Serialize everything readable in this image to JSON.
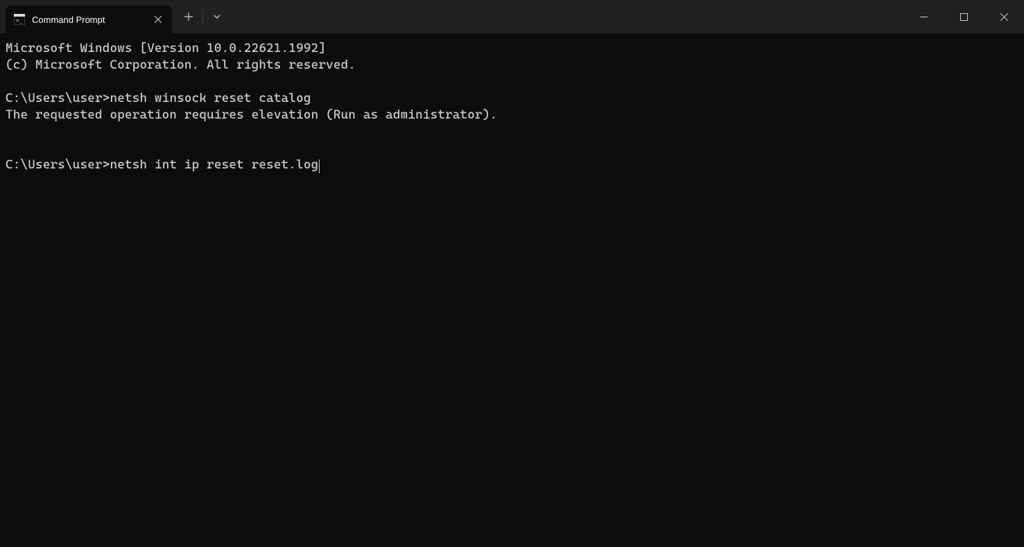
{
  "titlebar": {
    "tab": {
      "title": "Command Prompt"
    }
  },
  "terminal": {
    "lines": [
      {
        "type": "output",
        "text": "Microsoft Windows [Version 10.0.22621.1992]"
      },
      {
        "type": "output",
        "text": "(c) Microsoft Corporation. All rights reserved."
      },
      {
        "type": "blank",
        "text": ""
      },
      {
        "type": "prompt",
        "prompt": "C:\\Users\\user>",
        "command": "netsh winsock reset catalog"
      },
      {
        "type": "output",
        "text": "The requested operation requires elevation (Run as administrator)."
      },
      {
        "type": "blank",
        "text": ""
      },
      {
        "type": "blank",
        "text": ""
      },
      {
        "type": "prompt",
        "prompt": "C:\\Users\\user>",
        "command": "netsh int ip reset reset.log",
        "cursor": true
      }
    ]
  }
}
